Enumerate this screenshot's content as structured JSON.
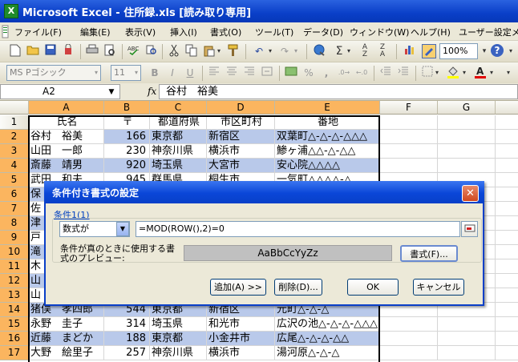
{
  "window": {
    "title": "Microsoft Excel - 住所録.xls [読み取り専用]",
    "icon": "X"
  },
  "menu": [
    "ファイル(F)",
    "編集(E)",
    "表示(V)",
    "挿入(I)",
    "書式(O)",
    "ツール(T)",
    "データ(D)",
    "ウィンドウ(W)",
    "ヘルプ(H)",
    "ユーザー設定メ"
  ],
  "toolbar1": {
    "zoom": "100%",
    "sigma": "Σ",
    "help": "?"
  },
  "toolbar2": {
    "font_name": "MS Pゴシック",
    "font_size": "11",
    "bold": "B",
    "italic": "I",
    "underline": "U",
    "percent": "%",
    "comma": ","
  },
  "formula_bar": {
    "name_box": "A2",
    "fx": "fx",
    "content": "谷村　裕美"
  },
  "columns": [
    "A",
    "B",
    "C",
    "D",
    "E",
    "F",
    "G"
  ],
  "rows": [
    "1",
    "2",
    "3",
    "4",
    "5",
    "6",
    "7",
    "8",
    "9",
    "10",
    "11",
    "12",
    "13",
    "14",
    "15",
    "16",
    "17"
  ],
  "cells": {
    "header": [
      "氏名",
      "〒",
      "都道府県",
      "市区町村",
      "番地"
    ],
    "r2": [
      "谷村　裕美",
      "166",
      "東京都",
      "新宿区",
      "双葉町△-△-△-△△△"
    ],
    "r3": [
      "山田　一郎",
      "230",
      "神奈川県",
      "横浜市",
      "鯵ヶ浦△△-△-△△"
    ],
    "r4": [
      "斎藤　靖男",
      "920",
      "埼玉県",
      "大宮市",
      "安心院△△△△"
    ],
    "r5": [
      "武田　和夫",
      "945",
      "群馬県",
      "桐生市",
      "一気町△△△△-△"
    ],
    "r6": [
      "保"
    ],
    "r7": [
      "佐"
    ],
    "r8": [
      "津"
    ],
    "r9": [
      "戸"
    ],
    "r10": [
      "滝"
    ],
    "r11": [
      "木"
    ],
    "r12": [
      "山"
    ],
    "r13": [
      "山"
    ],
    "r14": [
      "猪俣　孝四郎",
      "544",
      "東京都",
      "新宿区",
      "元町△-△-△"
    ],
    "r15": [
      "永野　圭子",
      "314",
      "埼玉県",
      "和光市",
      "広沢の池△-△-△-△△△"
    ],
    "r16": [
      "近藤　まどか",
      "188",
      "東京都",
      "小金井市",
      "広尾△-△-△-△△"
    ],
    "r17": [
      "大野　絵里子",
      "257",
      "神奈川県",
      "横浜市",
      "湯河原△-△-△"
    ]
  },
  "dialog": {
    "title": "条件付き書式の設定",
    "condition_label": "条件1(1)",
    "type_value": "数式が",
    "formula": "=MOD(ROW(),2)=0",
    "preview_label_1": "条件が真のときに使用する書",
    "preview_label_2": "式のプレビュー:",
    "preview_text": "AaBbCcYyZz",
    "format_button": "書式(F)...",
    "add_button": "追加(A) >>",
    "delete_button": "削除(D)...",
    "ok_button": "OK",
    "cancel_button": "キャンセル",
    "close": "✕"
  },
  "colors": {
    "title_bar": "#0a3fc8",
    "selected_header": "#fbb55f",
    "highlight_row": "#b9c9ea"
  }
}
